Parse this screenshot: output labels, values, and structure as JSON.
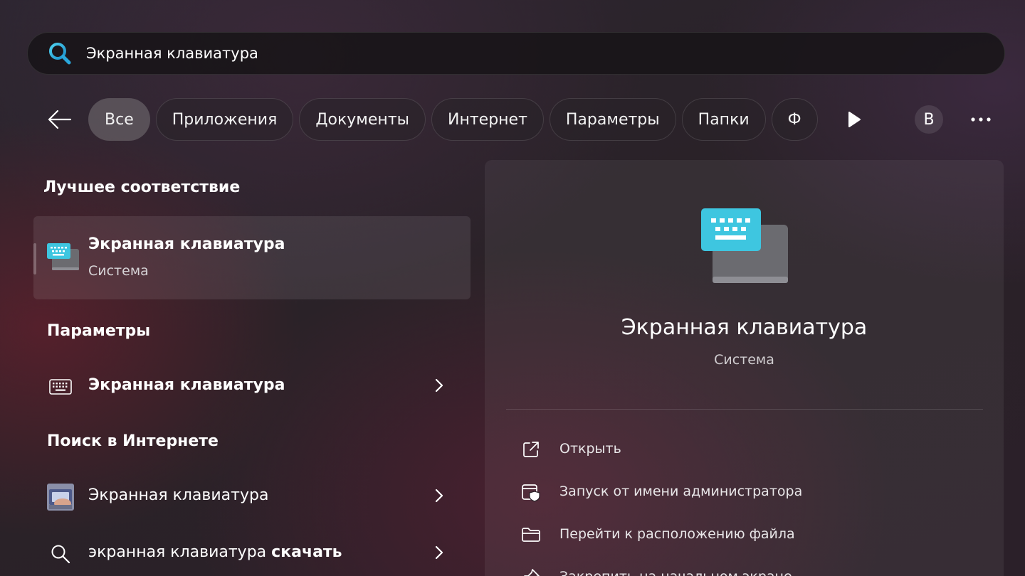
{
  "search": {
    "value": "Экранная клавиатура",
    "placeholder": ""
  },
  "filters": {
    "chips": [
      "Все",
      "Приложения",
      "Документы",
      "Интернет",
      "Параметры",
      "Папки",
      "Ф"
    ],
    "active": "Все",
    "avatar_letter": "B"
  },
  "sections": {
    "best_match_title": "Лучшее соответствие",
    "settings_title": "Параметры",
    "web_title": "Поиск в Интернете"
  },
  "best_match": {
    "name": "Экранная клавиатура",
    "type": "Система"
  },
  "settings_results": [
    {
      "label": "Экранная клавиатура"
    }
  ],
  "web_results": [
    {
      "label": "Экранная клавиатура"
    },
    {
      "label_prefix": "экранная клавиатура ",
      "label_bold": "скачать"
    }
  ],
  "detail": {
    "title": "Экранная клавиатура",
    "subtitle": "Система",
    "actions": [
      {
        "label": "Открыть",
        "icon": "open-external-icon"
      },
      {
        "label": "Запуск от имени администратора",
        "icon": "admin-shield-icon"
      },
      {
        "label": "Перейти к расположению файла",
        "icon": "folder-icon"
      },
      {
        "label": "Закрепить на начальном экране",
        "icon": "pin-icon"
      }
    ]
  },
  "colors": {
    "keyboard_blue": "#3ec6e0",
    "keyboard_grey": "#6b6b70"
  }
}
